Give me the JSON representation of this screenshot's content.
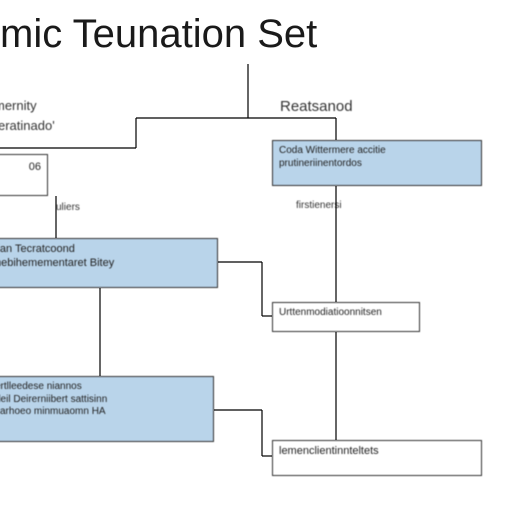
{
  "title": "mic  Teunation Set",
  "labels": {
    "left_upper1": "mernity",
    "left_upper2": "eratinado'",
    "left_footer": "uliers",
    "right_header": "Reatsanod",
    "mid_under": "firstienersi"
  },
  "boxes": {
    "left_count": "06",
    "right_top": "Coda Wittermere   accitie\nprutineriinentordos",
    "left_mid": "lian Tecratcoond\nnebihemementaret   Bitey",
    "right_small": "Urttenmodiatioonnitsen",
    "bottom_left": "ertlleedese niannos\ndeil Deirerniibert   sattisinn\ncarhoeo minmuaomn HA",
    "bottom_right": "lemenclientinnteltets"
  }
}
